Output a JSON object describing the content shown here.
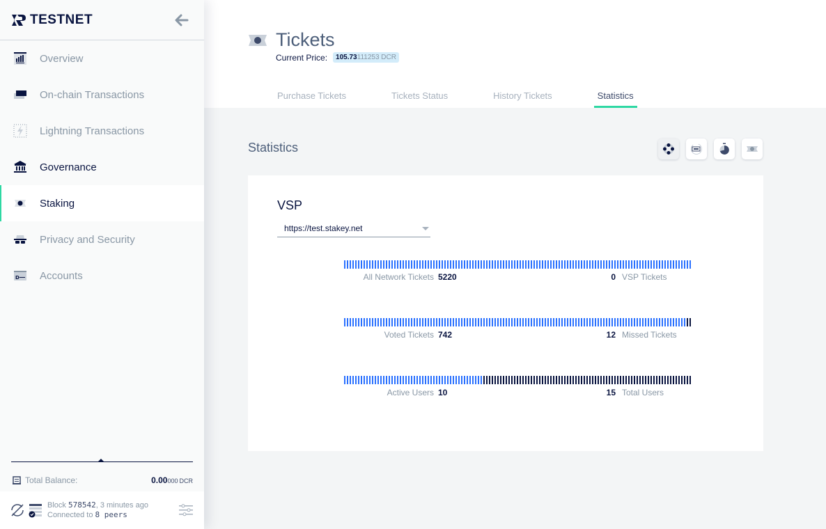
{
  "app": {
    "network_label": "TESTNET"
  },
  "sidebar": {
    "items": [
      {
        "label": "Overview",
        "icon": "overview-icon",
        "state": "muted"
      },
      {
        "label": "On-chain Transactions",
        "icon": "transactions-icon",
        "state": "muted"
      },
      {
        "label": "Lightning Transactions",
        "icon": "lightning-icon",
        "state": "muted"
      },
      {
        "label": "Governance",
        "icon": "governance-icon",
        "state": "dark"
      },
      {
        "label": "Staking",
        "icon": "staking-icon",
        "state": "active"
      },
      {
        "label": "Privacy and Security",
        "icon": "privacy-icon",
        "state": "muted"
      },
      {
        "label": "Accounts",
        "icon": "accounts-icon",
        "state": "muted"
      }
    ],
    "balance": {
      "label": "Total Balance:",
      "value_main": "0.00",
      "value_small": "000",
      "unit": "DCR"
    },
    "status": {
      "block_label": "Block",
      "block_number": "578542",
      "block_age": ", 3 minutes ago",
      "connected_label": "Connected to",
      "peers": "8 peers"
    }
  },
  "header": {
    "title": "Tickets",
    "price_label": "Current Price:",
    "price_main": "105.73",
    "price_rest": "111253 DCR",
    "tabs": [
      {
        "label": "Purchase Tickets",
        "active": false
      },
      {
        "label": "Tickets Status",
        "active": false
      },
      {
        "label": "History Tickets",
        "active": false
      },
      {
        "label": "Statistics",
        "active": true
      }
    ]
  },
  "content": {
    "section_title": "Statistics",
    "view_buttons": [
      "vsp-stats-icon",
      "purchase-stats-icon",
      "time-stats-icon",
      "ticket-stats-icon"
    ],
    "vsp": {
      "title": "VSP",
      "selected": "https://test.stakey.net"
    },
    "stats": [
      {
        "left_label": "All Network Tickets",
        "left_value": "5220",
        "right_value": "0",
        "right_label": "VSP Tickets",
        "left_fraction": 1.0
      },
      {
        "left_label": "Voted Tickets",
        "left_value": "742",
        "right_value": "12",
        "right_label": "Missed Tickets",
        "left_fraction": 0.984
      },
      {
        "left_label": "Active Users",
        "left_value": "10",
        "right_value": "15",
        "right_label": "Total Users",
        "left_fraction": 0.4
      }
    ]
  },
  "colors": {
    "accent": "#2ed8a3",
    "blue": "#2970ff",
    "dark": "#091440"
  }
}
